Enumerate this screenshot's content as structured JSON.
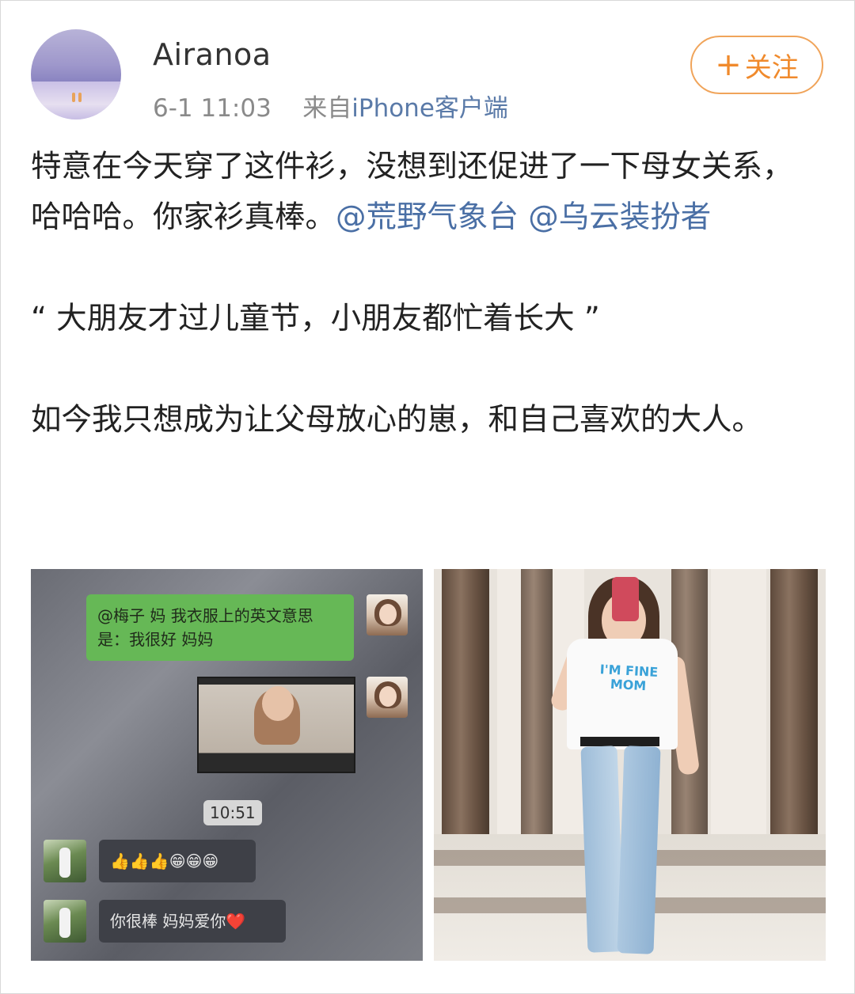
{
  "post": {
    "username": "Airanoa",
    "date": "6-1 11:03",
    "source_prefix": "来自",
    "source_device": "iPhone客户端",
    "follow_button": {
      "plus": "+",
      "label": "关注"
    },
    "paragraph1_text": "特意在今天穿了这件衫，没想到还促进了一下母女关系，哈哈哈。你家衫真棒。",
    "mention1": "@荒野气象台",
    "mention2": "@乌云装扮者",
    "paragraph2": "“ 大朋友才过儿童节，小朋友都忙着长大 ”",
    "paragraph3": "如今我只想成为让父母放心的崽，和自己喜欢的大人。"
  },
  "images": {
    "left": {
      "green_bubble": "@梅子 妈 我衣服上的英文意思是：我很好 妈妈",
      "time": "10:51",
      "reply1": "👍👍👍😁😁😁",
      "reply2": "你很棒  妈妈爱你❤️"
    },
    "right": {
      "tshirt_text": "I'M FINE MOM"
    }
  },
  "colors": {
    "mention": "#4a6fa5",
    "follow": "#f08a2c",
    "meta": "#8a8a8a"
  }
}
